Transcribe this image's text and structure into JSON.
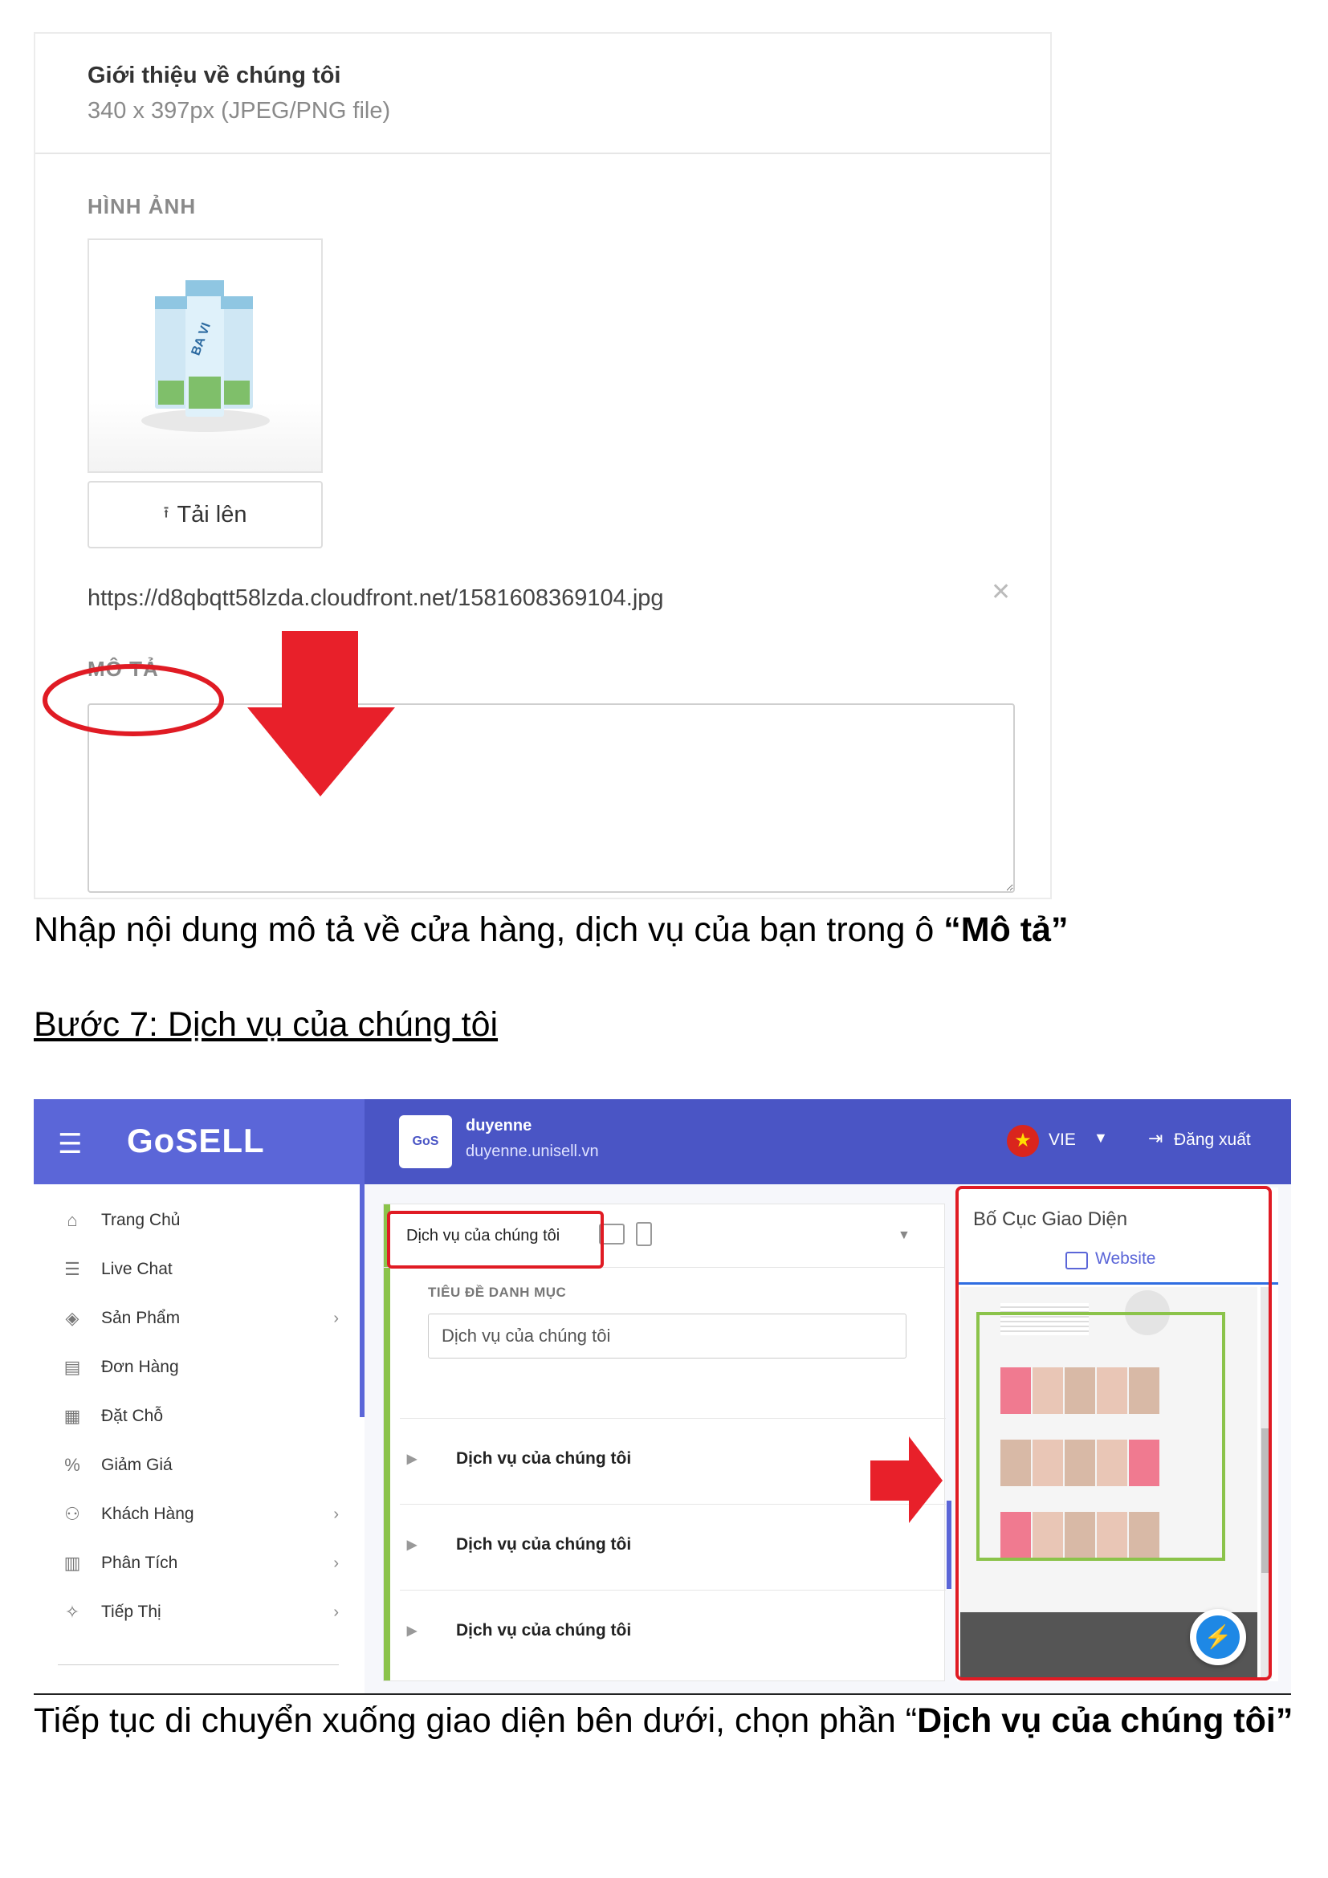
{
  "section1": {
    "title": "Giới thiệu về chúng tôi",
    "subtitle": "340 x 397px (JPEG/PNG file)",
    "image_label": "HÌNH ẢNH",
    "upload_label": "Tải lên",
    "image_url": "https://d8qbqtt58lzda.cloudfront.net/1581608369104.jpg",
    "description_label": "MÔ TẢ",
    "description_value": ""
  },
  "caption1": {
    "text": "Nhập nội dung mô tả về cửa hàng, dịch vụ của bạn trong ô ",
    "bold": "“Mô tả”"
  },
  "step7": {
    "heading": "Bước 7: Dịch vụ của chúng tôi"
  },
  "app": {
    "brand": "GoSELL",
    "store_name": "duyenne",
    "store_domain": "duyenne.unisell.vn",
    "language": "VIE",
    "logout": "Đăng xuất",
    "sidebar": [
      {
        "label": "Trang Chủ",
        "icon": "home-icon",
        "chevron": false
      },
      {
        "label": "Live Chat",
        "icon": "chat-icon",
        "chevron": false
      },
      {
        "label": "Sản Phẩm",
        "icon": "tag-icon",
        "chevron": true
      },
      {
        "label": "Đơn Hàng",
        "icon": "order-icon",
        "chevron": false
      },
      {
        "label": "Đặt Chỗ",
        "icon": "calendar-icon",
        "chevron": false
      },
      {
        "label": "Giảm Giá",
        "icon": "discount-icon",
        "chevron": false
      },
      {
        "label": "Khách Hàng",
        "icon": "customers-icon",
        "chevron": true
      },
      {
        "label": "Phân Tích",
        "icon": "analytics-icon",
        "chevron": true
      },
      {
        "label": "Tiếp Thị",
        "icon": "marketing-icon",
        "chevron": true
      }
    ],
    "editor": {
      "section_name": "Dịch vụ của chúng tôi",
      "category_title_label": "TIÊU ĐỀ DANH MỤC",
      "category_title_value": "Dịch vụ của chúng tôi",
      "items": [
        "Dịch vụ của chúng tôi",
        "Dịch vụ của chúng tôi",
        "Dịch vụ của chúng tôi"
      ]
    },
    "preview": {
      "title": "Bố Cục Giao Diện",
      "tab": "Website"
    }
  },
  "caption2": {
    "text": "Tiếp tục di chuyển xuống giao diện bên dưới, chọn phần “",
    "bold": "Dịch vụ của chúng tôi”"
  },
  "colors": {
    "header": "#4a55c5",
    "accent": "#5b66d8",
    "annotation_red": "#e01b24",
    "highlight_green": "#8bc34a"
  }
}
